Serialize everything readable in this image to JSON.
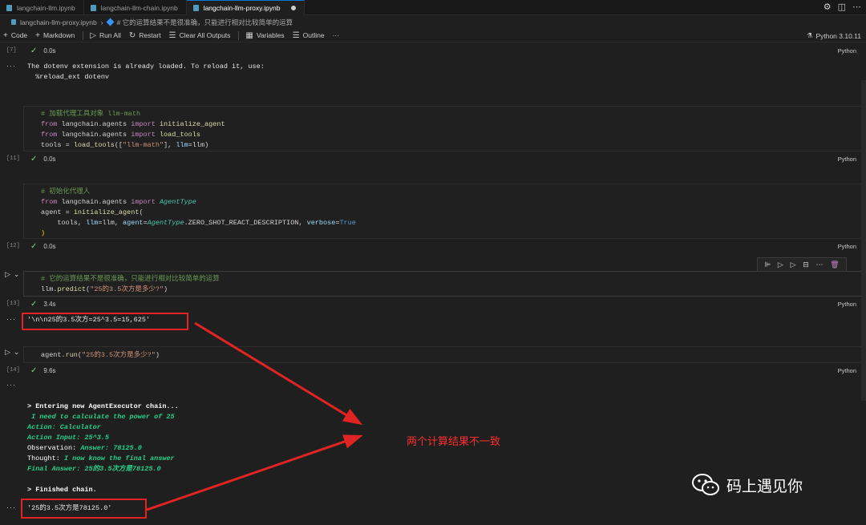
{
  "tabs": [
    {
      "label": "langchain-llm.ipynb"
    },
    {
      "label": "langchain-llm-chain.ipynb"
    },
    {
      "label": "langchain-llm-proxy.ipynb"
    }
  ],
  "breadcrumb": {
    "file": "langchain-llm-proxy.ipynb",
    "cell": "# 它的运算结果不是很准确，只能进行相对比较简单的运算"
  },
  "toolbar": {
    "code": "Code",
    "markdown": "Markdown",
    "run_all": "Run All",
    "restart": "Restart",
    "clear_outputs": "Clear All Outputs",
    "variables": "Variables",
    "outline": "Outline",
    "more": "···",
    "kernel": "Python 3.10.11"
  },
  "cells": {
    "c7": {
      "count": "[7]",
      "time": "0.0s",
      "lang": "Python",
      "output": [
        "The dotenv extension is already loaded. To reload it, use:",
        "  %reload_ext dotenv"
      ]
    },
    "c11": {
      "count": "[11]",
      "time": "0.0s",
      "lang": "Python",
      "comment": "# 加载代理工具对象 llm-math",
      "l2a": "from",
      "l2b": " langchain.agents ",
      "l2c": "import",
      "l2d": "initialize_agent",
      "l3a": "from",
      "l3b": " langchain.agents ",
      "l3c": "import",
      "l3d": "load_tools",
      "l4a": "tools = ",
      "l4b": "load_tools",
      "l4c": "([",
      "l4d": "\"llm-math\"",
      "l4e": "], ",
      "l4f": "llm",
      "l4g": "=llm)"
    },
    "c12": {
      "count": "[12]",
      "time": "0.0s",
      "lang": "Python",
      "comment": "# 初始化代理人",
      "l2a": "from",
      "l2b": " langchain.agents ",
      "l2c": "import",
      "l2d": "AgentType",
      "l3a": "agent = ",
      "l3b": "initialize_agent",
      "l3c": "(",
      "l4a": "    tools, ",
      "l4b": "llm",
      "l4c": "=llm, ",
      "l4d": "agent",
      "l4e": "=",
      "l4f": "AgentType",
      "l4g": ".ZERO_SHOT_REACT_DESCRIPTION, ",
      "l4h": "verbose",
      "l4i": "=",
      "l4j": "True",
      "l5": ")"
    },
    "c13": {
      "count": "[13]",
      "time": "3.4s",
      "lang": "Python",
      "comment": "# 它的运算结果不是很准确，只能进行相对比较简单的运算",
      "l2a": "llm.",
      "l2b": "predict",
      "l2c": "(",
      "l2d": "\"25的3.5次方是多少?\"",
      "l2e": ")",
      "output": "'\\n\\n25的3.5次方=25^3.5=15,625'"
    },
    "c14": {
      "count": "[14]",
      "time": "9.6s",
      "lang": "Python",
      "l1a": "agent.",
      "l1b": "run",
      "l1c": "(",
      "l1d": "\"25的3.5次方是多少?\"",
      "l1e": ")",
      "out_enter": "> Entering new AgentExecutor chain...",
      "out_thought1": " I need to calculate the power of 25",
      "out_action": "Action: Calculator",
      "out_input": "Action Input: 25^3.5",
      "out_obs_a": "Observation: ",
      "out_obs_b": "Answer: 78125.0",
      "out_th_a": "Thought: ",
      "out_th_b": "I now know the final answer",
      "out_final": "Final Answer: 25的3.5次方是78125.0",
      "out_finished": "> Finished chain.",
      "output": "'25的3.5次方是78125.0'"
    }
  },
  "annotation": "两个计算结果不一致",
  "watermark": "码上遇见你",
  "colors": {
    "accent": "#0078d4",
    "annotation": "#e02424",
    "output_green": "#23d18b"
  }
}
